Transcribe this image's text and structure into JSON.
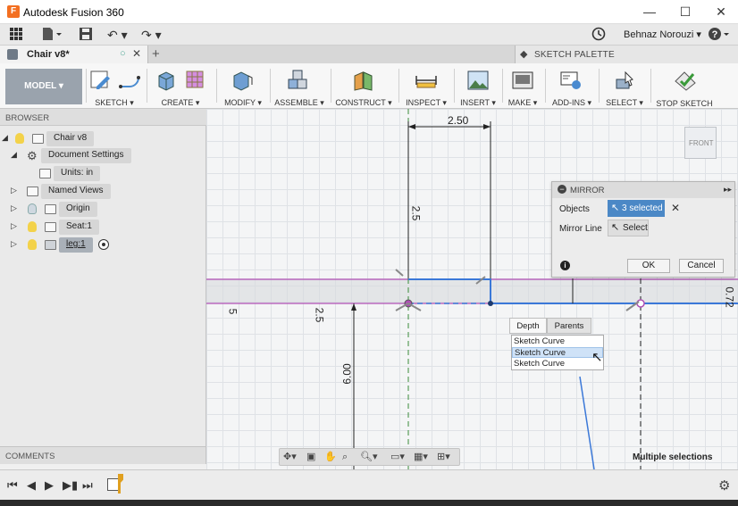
{
  "window": {
    "app_title": "Autodesk Fusion 360",
    "app_icon": "fusion-icon",
    "user_name": "Behnaz Norouzi"
  },
  "document_tab": {
    "name": "Chair v8*"
  },
  "sketch_palette": {
    "title": "SKETCH PALETTE"
  },
  "ribbon": {
    "workspace": "MODEL",
    "groups": [
      {
        "label": "SKETCH ▾",
        "icon": "sketch-icon"
      },
      {
        "label": "CREATE ▾",
        "icon": "create-icon"
      },
      {
        "label": "MODIFY ▾",
        "icon": "modify-icon"
      },
      {
        "label": "ASSEMBLE ▾",
        "icon": "assemble-icon"
      },
      {
        "label": "CONSTRUCT ▾",
        "icon": "construct-icon"
      },
      {
        "label": "INSPECT ▾",
        "icon": "inspect-icon"
      },
      {
        "label": "INSERT ▾",
        "icon": "insert-icon"
      },
      {
        "label": "MAKE ▾",
        "icon": "make-icon"
      },
      {
        "label": "ADD-INS ▾",
        "icon": "add-ins-icon"
      },
      {
        "label": "SELECT ▾",
        "icon": "select-icon"
      },
      {
        "label": "STOP SKETCH",
        "icon": "stop-sketch-icon"
      }
    ]
  },
  "browser": {
    "title": "BROWSER",
    "items": [
      {
        "label": "Chair v8"
      },
      {
        "label": "Document Settings"
      },
      {
        "label": "Units: in"
      },
      {
        "label": "Named Views"
      },
      {
        "label": "Origin"
      },
      {
        "label": "Seat:1"
      },
      {
        "label": "leg:1"
      }
    ]
  },
  "comments": {
    "title": "COMMENTS"
  },
  "canvas": {
    "dimensions": [
      "2.50",
      "2.5",
      "5",
      "2.5",
      "6.00",
      "0.72"
    ],
    "viewcube_label": "FRONT",
    "status_message": "Multiple selections"
  },
  "mirror_dialog": {
    "title": "MIRROR",
    "objects_label": "Objects",
    "objects_value": "3 selected",
    "mirror_line_label": "Mirror Line",
    "mirror_line_value": "Select",
    "ok_label": "OK",
    "cancel_label": "Cancel"
  },
  "selection_popup": {
    "tabs": [
      "Depth",
      "Parents"
    ],
    "items": [
      "Sketch Curve",
      "Sketch Curve",
      "Sketch Curve"
    ]
  },
  "colors": {
    "accent": "#4b88c6",
    "sketch_line": "#3b78d8",
    "profile_line": "#b04fb5"
  }
}
